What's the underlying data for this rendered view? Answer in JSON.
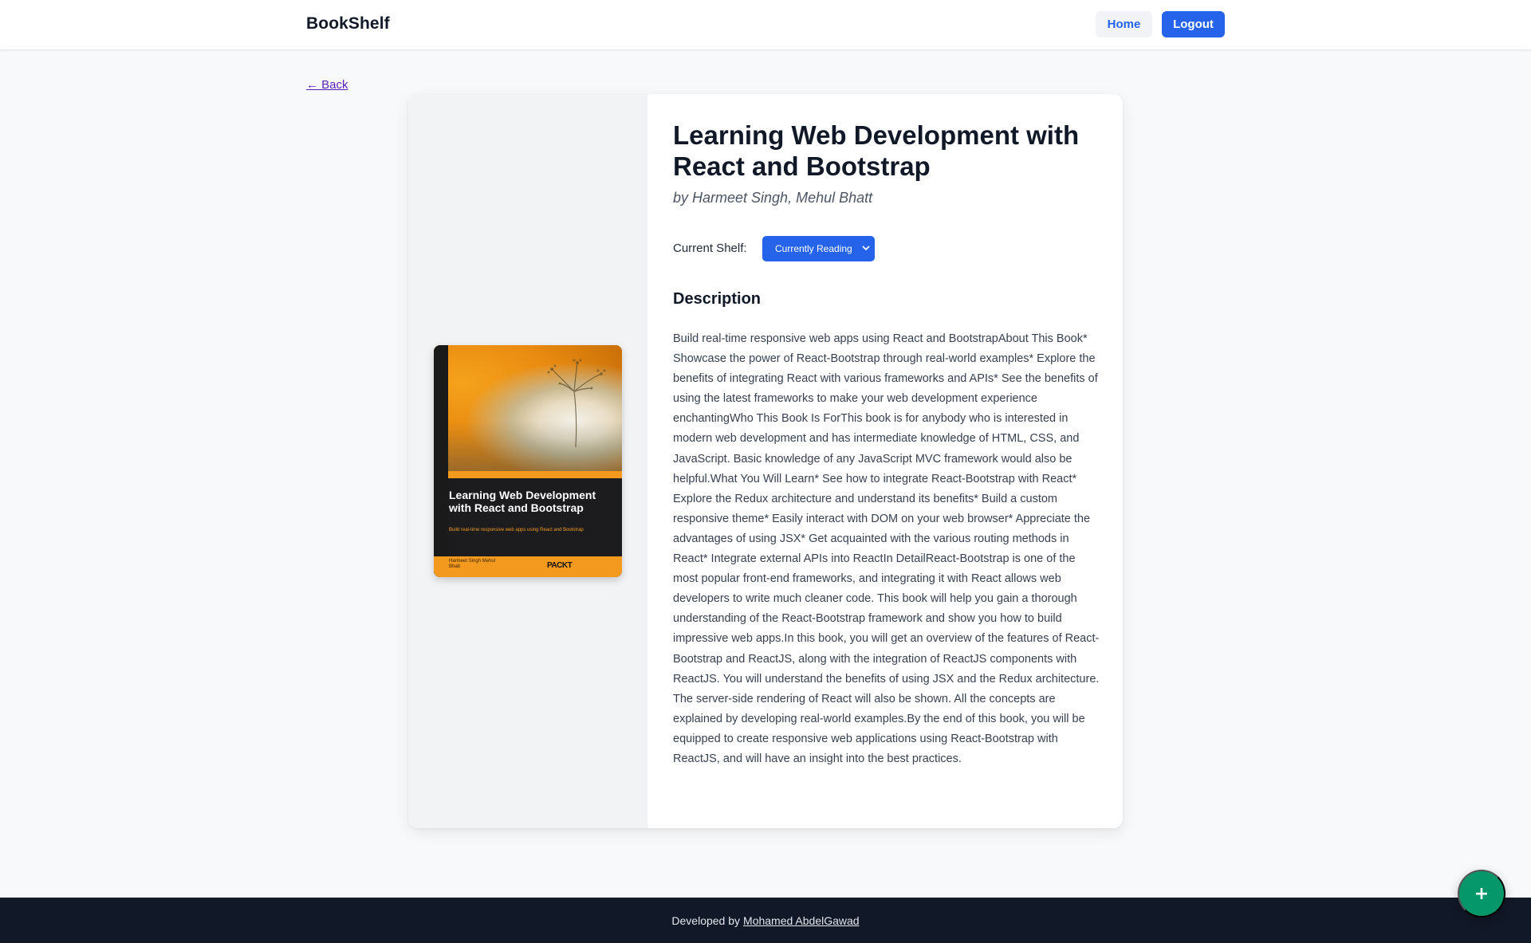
{
  "header": {
    "brand": "BookShelf",
    "nav": {
      "home": "Home",
      "logout": "Logout"
    }
  },
  "back_label": "← Back",
  "book": {
    "title": "Learning Web Development with React and Bootstrap",
    "authors": "by Harmeet Singh, Mehul Bhatt",
    "cover": {
      "title": "Learning Web Development with React and Bootstrap",
      "subtitle": "Build real-time responsive web apps using React and Bootstrap",
      "authors": "Harmeet Singh Mehul Bhatt",
      "publisher": "PACKT"
    },
    "shelf_label": "Current Shelf:",
    "shelf_value": "Currently Reading",
    "description_heading": "Description",
    "description": "Build real-time responsive web apps using React and BootstrapAbout This Book* Showcase the power of React-Bootstrap through real-world examples* Explore the benefits of integrating React with various frameworks and APIs* See the benefits of using the latest frameworks to make your web development experience enchantingWho This Book Is ForThis book is for anybody who is interested in modern web development and has intermediate knowledge of HTML, CSS, and JavaScript. Basic knowledge of any JavaScript MVC framework would also be helpful.What You Will Learn* See how to integrate React-Bootstrap with React* Explore the Redux architecture and understand its benefits* Build a custom responsive theme* Easily interact with DOM on your web browser* Appreciate the advantages of using JSX* Get acquainted with the various routing methods in React* Integrate external APIs into ReactIn DetailReact-Bootstrap is one of the most popular front-end frameworks, and integrating it with React allows web developers to write much cleaner code. This book will help you gain a thorough understanding of the React-Bootstrap framework and show you how to build impressive web apps.In this book, you will get an overview of the features of React-Bootstrap and ReactJS, along with the integration of ReactJS components with ReactJS. You will understand the benefits of using JSX and the Redux architecture. The server-side rendering of React will also be shown. All the concepts are explained by developing real-world examples.By the end of this book, you will be equipped to create responsive web applications using React-Bootstrap with ReactJS, and will have an insight into the best practices."
  },
  "footer": {
    "prefix": "Developed by",
    "author_link": "Mohamed AbdelGawad"
  },
  "fab": {
    "icon": "plus-icon",
    "symbol": "+"
  },
  "colors": {
    "accent": "#2563eb",
    "fab": "#059669",
    "footer_bg": "#111827"
  }
}
